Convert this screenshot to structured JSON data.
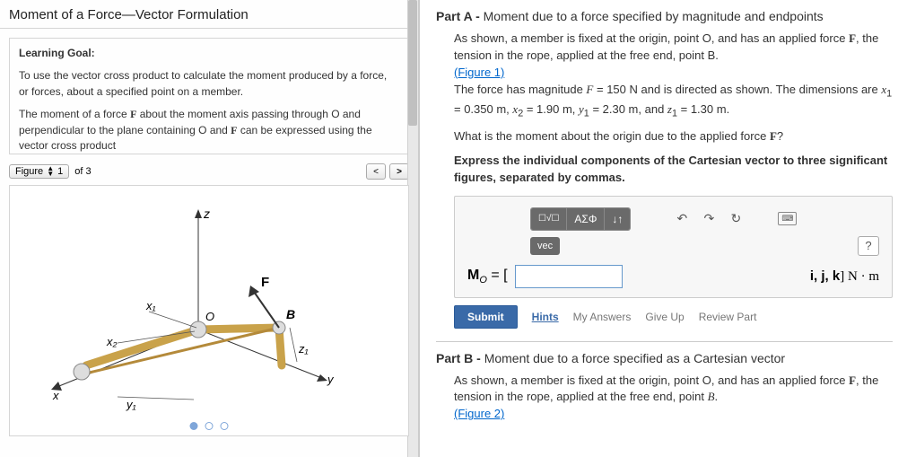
{
  "title": "Moment of a Force—Vector Formulation",
  "intro": {
    "heading": "Learning Goal:",
    "p1": "To use the vector cross product to calculate the moment produced by a force, or forces, about a specified point on a member.",
    "p2_a": "The moment of a force ",
    "p2_b": " about the moment axis passing through O and perpendicular to the plane containing O and ",
    "p2_c": " can be expressed using the vector cross product"
  },
  "figure": {
    "label": "Figure",
    "current": "1",
    "of": "of 3",
    "labels": {
      "z": "z",
      "F": "F",
      "B": "B",
      "O": "O",
      "x1": "x₁",
      "x2": "x₂",
      "z1": "z₁",
      "y": "y",
      "x": "x",
      "y1": "y₁"
    }
  },
  "partA": {
    "head_bold": "Part A - ",
    "head_rest": "Moment due to a force specified by magnitude and endpoints",
    "p1_a": "As shown, a member is fixed at the origin, point O, and has an applied force ",
    "p1_b": ", the tension in the rope, applied at the free end, point B.",
    "fig_link": "(Figure 1)",
    "p2_a": "The force has magnitude ",
    "p2_b": " = 150 N and is directed as shown. The dimensions are ",
    "p2_c": " = 0.350 m, ",
    "p2_d": " = 1.90 m, ",
    "p2_e": " = 2.30 m, and ",
    "p2_f": " = 1.30 m.",
    "q_a": "What is the moment about the origin due to the applied force ",
    "q_b": "?",
    "instruct": "Express the individual components of the Cartesian vector to three significant figures, separated by commas.",
    "toolbar": {
      "tpl": "☐√☐",
      "greek": "ΑΣΦ",
      "updown": "↓↑",
      "undo": "↶",
      "redo": "↷",
      "reset": "↻",
      "kbd": "⌨",
      "vec": "vec",
      "help": "?"
    },
    "mo": "M",
    "mo_sub": "O",
    "eq": " = [",
    "units": "i, j, k] N · m",
    "submit": "Submit",
    "hints": "Hints",
    "myans": "My Answers",
    "giveup": "Give Up",
    "review": "Review Part"
  },
  "partB": {
    "head_bold": "Part B - ",
    "head_rest": "Moment due to a force specified as a Cartesian vector",
    "p1_a": "As shown, a member is fixed at the origin, point O, and has an applied force ",
    "p1_b": ", the tension in the rope, applied at the free end, point ",
    "p1_c": ".",
    "fig_link": "(Figure 2)"
  }
}
